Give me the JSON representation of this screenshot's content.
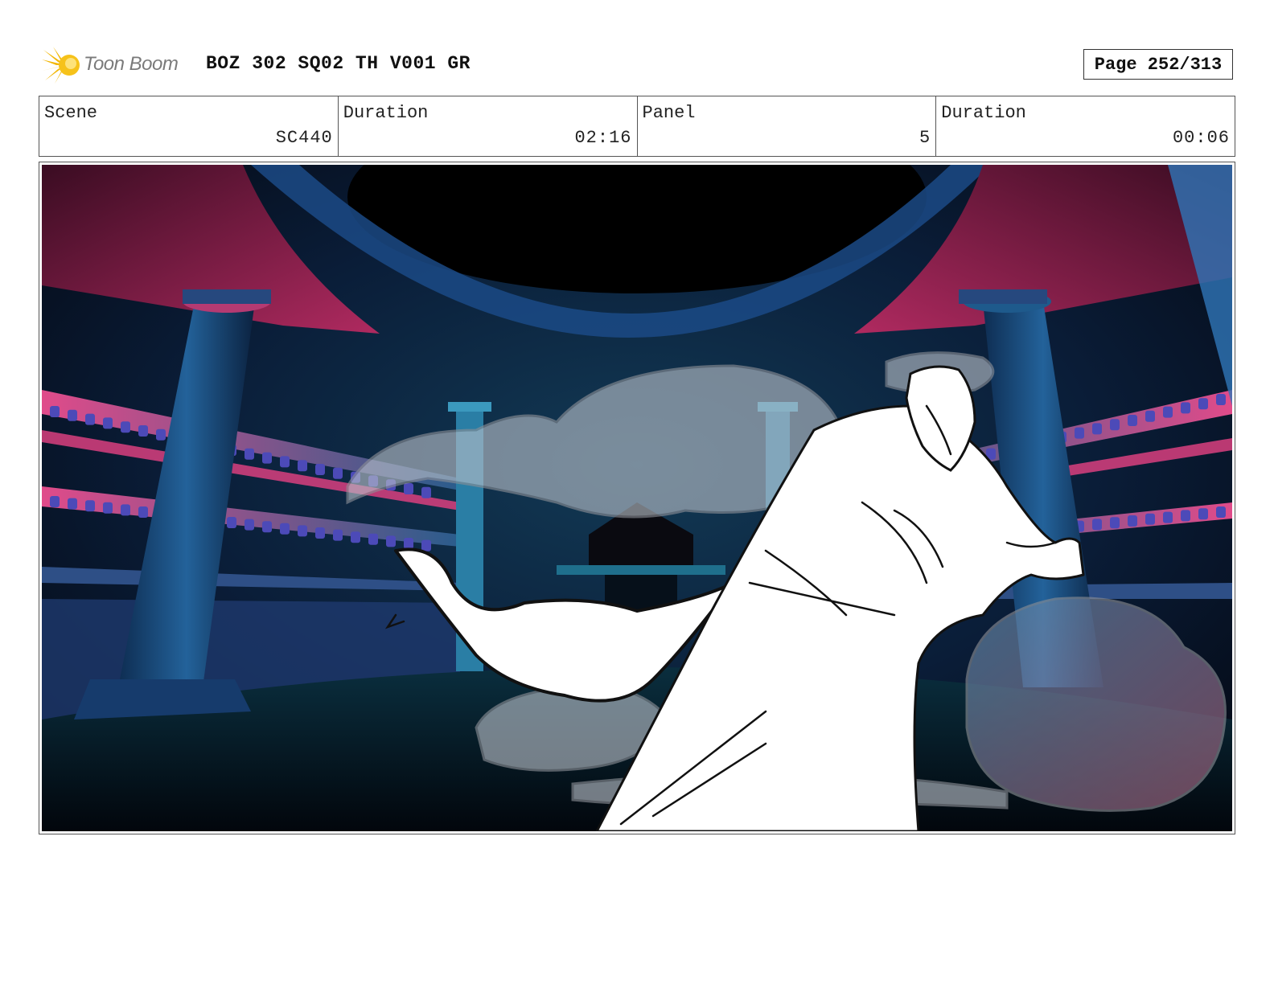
{
  "header": {
    "logo_text": "Toon Boom",
    "title": "BOZ 302 SQ02 TH V001 GR",
    "page": "Page 252/313"
  },
  "info": {
    "scene_label": "Scene",
    "scene_value": "SC440",
    "scene_duration_label": "Duration",
    "scene_duration_value": "02:16",
    "panel_label": "Panel",
    "panel_value": "5",
    "panel_duration_label": "Duration",
    "panel_duration_value": "00:06"
  },
  "colors": {
    "logo_star": "#f2b705",
    "scene_magenta": "#c8336e",
    "scene_teal": "#1e6f8a",
    "scene_navy": "#0c1d3d"
  }
}
